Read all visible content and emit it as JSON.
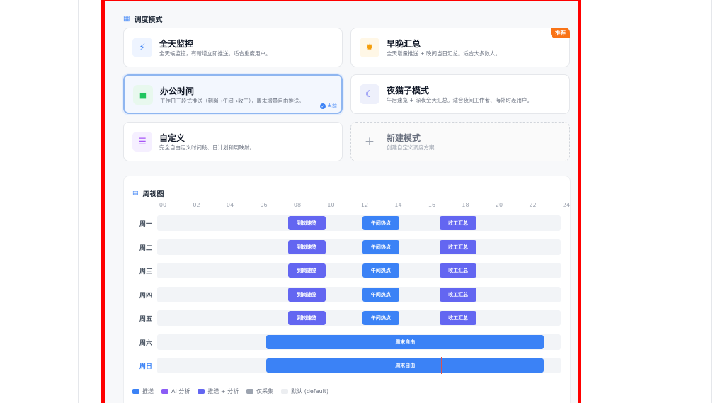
{
  "section": {
    "title": "调度模式"
  },
  "modes": [
    {
      "title": "全天监控",
      "desc": "全天候监控，有新增立即推送。适合重度用户。",
      "icon": "lightning-icon",
      "glyph": "⚡",
      "icon_bg": "#eef4ff",
      "icon_color": "#3b82f6"
    },
    {
      "title": "早晚汇总",
      "desc": "全天增量推送 + 晚间当日汇总。适合大多数人。",
      "icon": "sun-icon",
      "glyph": "✹",
      "icon_bg": "#fff7e6",
      "icon_color": "#f59e0b",
      "badge": "推荐"
    },
    {
      "title": "办公时间",
      "desc": "工作日三段式推送（到岗→午间→收工），周末增量自由推送。",
      "icon": "briefcase-icon",
      "glyph": "■",
      "icon_bg": "#e8f8ee",
      "icon_color": "#22c55e",
      "current": "当前"
    },
    {
      "title": "夜猫子模式",
      "desc": "午后速览 + 深夜全天汇总。适合夜间工作者、海外时差用户。",
      "icon": "moon-icon",
      "glyph": "☾",
      "icon_bg": "#eef0fb",
      "icon_color": "#6366f1"
    },
    {
      "title": "自定义",
      "desc": "完全自由定义时间段、日计划和周映射。",
      "icon": "sliders-icon",
      "glyph": "☰",
      "icon_bg": "#f5efff",
      "icon_color": "#a855f7"
    },
    {
      "title": "新建模式",
      "desc": "创建自定义调度方案",
      "icon": "plus-icon",
      "glyph": "+",
      "icon_bg": "#fafafa",
      "icon_color": "#9ca3af"
    }
  ],
  "week_view": {
    "title": "周视图",
    "hours": [
      "00",
      "02",
      "04",
      "06",
      "08",
      "10",
      "12",
      "14",
      "16",
      "18",
      "20",
      "22",
      "24"
    ],
    "days": [
      {
        "label": "周一",
        "today": false,
        "blocks": [
          {
            "label": "到岗速览",
            "start": 7.8,
            "end": 10.0,
            "type": "combo"
          },
          {
            "label": "午间热点",
            "start": 12.2,
            "end": 14.4,
            "type": "push"
          },
          {
            "label": "收工汇总",
            "start": 16.8,
            "end": 19.0,
            "type": "combo"
          }
        ]
      },
      {
        "label": "周二",
        "today": false,
        "blocks": [
          {
            "label": "到岗速览",
            "start": 7.8,
            "end": 10.0,
            "type": "combo"
          },
          {
            "label": "午间热点",
            "start": 12.2,
            "end": 14.4,
            "type": "push"
          },
          {
            "label": "收工汇总",
            "start": 16.8,
            "end": 19.0,
            "type": "combo"
          }
        ]
      },
      {
        "label": "周三",
        "today": false,
        "blocks": [
          {
            "label": "到岗速览",
            "start": 7.8,
            "end": 10.0,
            "type": "combo"
          },
          {
            "label": "午间热点",
            "start": 12.2,
            "end": 14.4,
            "type": "push"
          },
          {
            "label": "收工汇总",
            "start": 16.8,
            "end": 19.0,
            "type": "combo"
          }
        ]
      },
      {
        "label": "周四",
        "today": false,
        "blocks": [
          {
            "label": "到岗速览",
            "start": 7.8,
            "end": 10.0,
            "type": "combo"
          },
          {
            "label": "午间热点",
            "start": 12.2,
            "end": 14.4,
            "type": "push"
          },
          {
            "label": "收工汇总",
            "start": 16.8,
            "end": 19.0,
            "type": "combo"
          }
        ]
      },
      {
        "label": "周五",
        "today": false,
        "blocks": [
          {
            "label": "到岗速览",
            "start": 7.8,
            "end": 10.0,
            "type": "combo"
          },
          {
            "label": "午间热点",
            "start": 12.2,
            "end": 14.4,
            "type": "push"
          },
          {
            "label": "收工汇总",
            "start": 16.8,
            "end": 19.0,
            "type": "combo"
          }
        ]
      },
      {
        "label": "周六",
        "today": false,
        "blocks": [
          {
            "label": "周末自由",
            "start": 6.5,
            "end": 23.0,
            "type": "push"
          }
        ]
      },
      {
        "label": "周日",
        "today": true,
        "now": 16.9,
        "blocks": [
          {
            "label": "周末自由",
            "start": 6.5,
            "end": 23.0,
            "type": "push"
          }
        ]
      }
    ]
  },
  "legend": [
    {
      "label": "推送",
      "type": "push"
    },
    {
      "label": "AI 分析",
      "type": "ai"
    },
    {
      "label": "推送 + 分析",
      "type": "combo"
    },
    {
      "label": "仅采集",
      "type": "collect"
    },
    {
      "label": "默认 (default)",
      "type": "default"
    }
  ],
  "colors": {
    "push": "#3b82f6",
    "ai": "#8b5cf6",
    "combo": "#6366f1",
    "collect": "#9ca3af",
    "default": "#eceef1",
    "accent": "#3b82f6",
    "frame": "#ff0000"
  }
}
